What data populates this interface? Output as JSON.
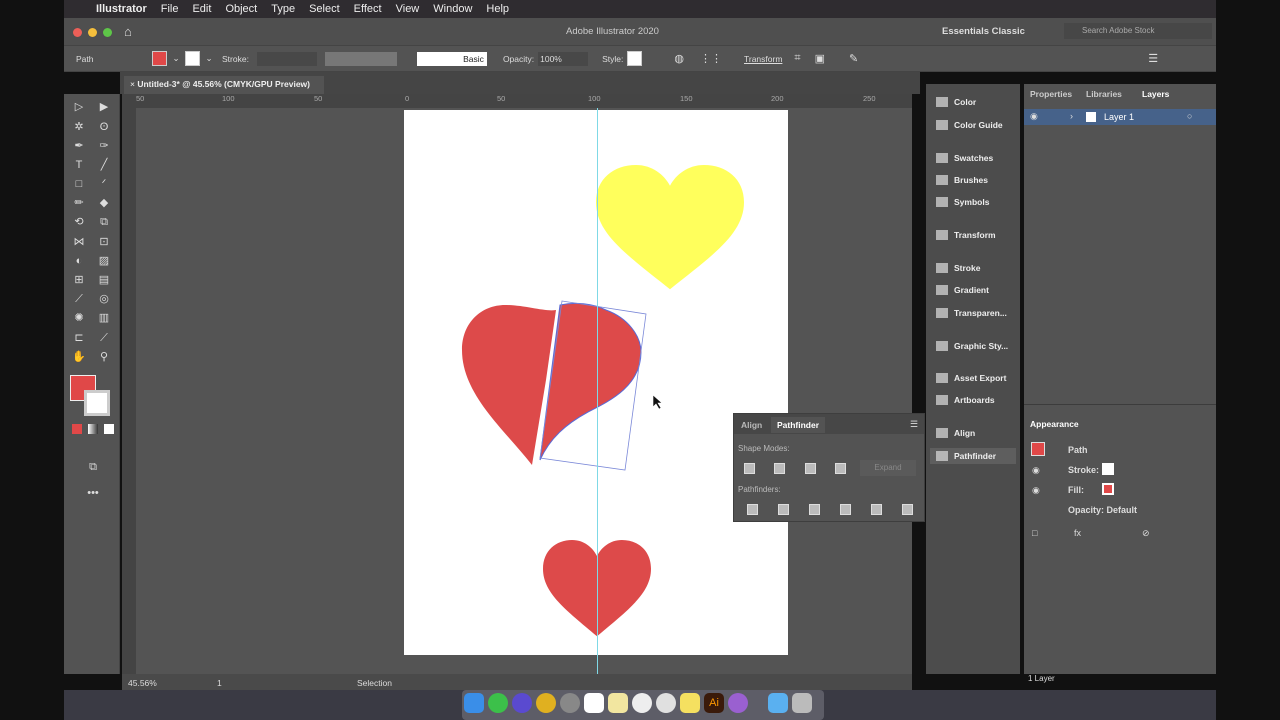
{
  "menubar": {
    "app": "Illustrator",
    "items": [
      "File",
      "Edit",
      "Object",
      "Type",
      "Select",
      "Effect",
      "View",
      "Window",
      "Help"
    ]
  },
  "titlebar": {
    "title": "Adobe Illustrator 2020",
    "workspace": "Essentials Classic",
    "search_placeholder": "Search Adobe Stock"
  },
  "control": {
    "selection": "Path",
    "stroke_label": "Stroke:",
    "brush": "Basic",
    "opacity_label": "Opacity:",
    "opacity": "100%",
    "style_label": "Style:",
    "transform": "Transform",
    "fill_color": "#e04848"
  },
  "document": {
    "tab": "Untitled-3* @ 45.56% (CMYK/GPU Preview)",
    "ruler": [
      "50",
      "100",
      "50",
      "0",
      "50",
      "100",
      "150",
      "200",
      "250"
    ]
  },
  "dock_panels": [
    "Color",
    "Color Guide",
    "Swatches",
    "Brushes",
    "Symbols",
    "Transform",
    "Stroke",
    "Gradient",
    "Transparen...",
    "Graphic Sty...",
    "Asset Export",
    "Artboards",
    "Align",
    "Pathfinder"
  ],
  "layers": {
    "tabs": [
      "Properties",
      "Libraries",
      "Layers"
    ],
    "active": "Layers",
    "layer": "Layer 1",
    "footer": "1 Layer"
  },
  "appearance": {
    "title": "Appearance",
    "object": "Path",
    "stroke": "Stroke:",
    "fill": "Fill:",
    "opacity": "Opacity: Default"
  },
  "pathfinder": {
    "tabs": [
      "Align",
      "Pathfinder"
    ],
    "shape_modes": "Shape Modes:",
    "expand": "Expand",
    "pathfinders": "Pathfinders:"
  },
  "status": {
    "zoom": "45.56%",
    "artboard": "1",
    "tool": "Selection"
  },
  "colors": {
    "heart_red": "#dd4a4a",
    "heart_yellow": "#ffff5c",
    "guide": "#7fd9e6"
  }
}
